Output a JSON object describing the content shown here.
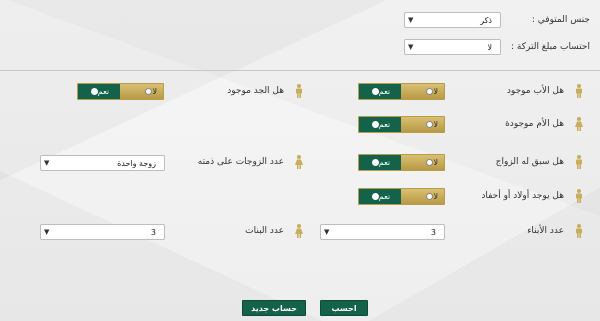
{
  "colors": {
    "primary_green": "#14624a",
    "gold": "#c8ad5c"
  },
  "top": {
    "gender_label": "جنس المتوفي :",
    "gender_value": "ذكر",
    "estate_label": "احتساب مبلغ التركة :",
    "estate_value": "لا"
  },
  "questions": {
    "father": {
      "label": "هل الأب موجود",
      "no": "لا",
      "yes": "نعم",
      "icon": "male-person-icon"
    },
    "grandfather": {
      "label": "هل الجد موجود",
      "no": "لا",
      "yes": "نعم",
      "icon": "male-person-icon"
    },
    "mother": {
      "label": "هل الأم موجودة",
      "no": "لا",
      "yes": "نعم",
      "icon": "female-person-icon"
    },
    "married": {
      "label": "هل سبق له الزواج",
      "no": "لا",
      "yes": "نعم",
      "icon": "male-person-icon"
    },
    "wives": {
      "label": "عدد الزوجات على ذمته",
      "value": "زوجة واحدة",
      "icon": "female-person-icon"
    },
    "children": {
      "label": "هل يوجد أولاد أو أحفاد",
      "no": "لا",
      "yes": "نعم",
      "icon": "male-person-icon"
    },
    "sons": {
      "label": "عدد الأبناء",
      "value": "3",
      "icon": "male-person-icon"
    },
    "daughters": {
      "label": "عدد البنات",
      "value": "3",
      "icon": "female-person-icon"
    }
  },
  "buttons": {
    "calculate": "احسب",
    "new_calculation": "حساب جديد"
  }
}
